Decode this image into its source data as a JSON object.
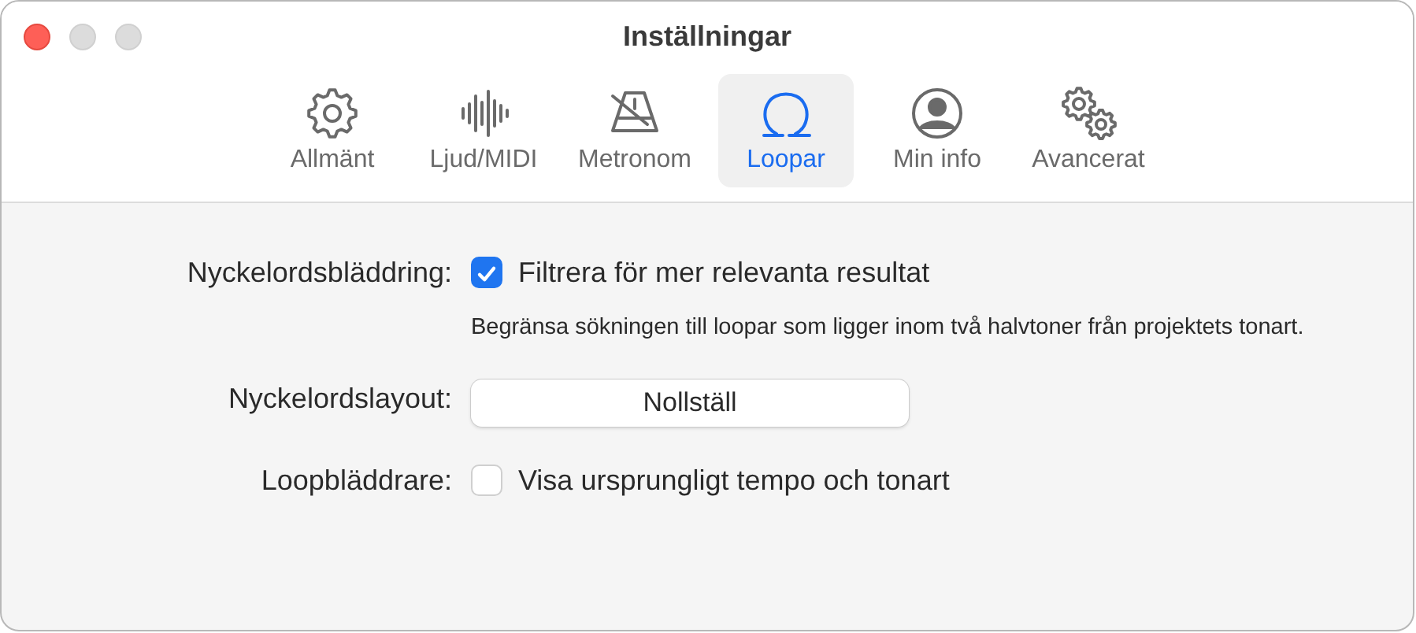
{
  "window": {
    "title": "Inställningar"
  },
  "tabs": [
    {
      "label": "Allmänt",
      "selected": false
    },
    {
      "label": "Ljud/MIDI",
      "selected": false
    },
    {
      "label": "Metronom",
      "selected": false
    },
    {
      "label": "Loopar",
      "selected": true
    },
    {
      "label": "Min info",
      "selected": false
    },
    {
      "label": "Avancerat",
      "selected": false
    }
  ],
  "rows": [
    {
      "kind": "checkbox",
      "label": "Nyckelordsbläddring:",
      "text": "Filtrera för mer relevanta resultat",
      "checked": true,
      "note": "Begränsa sökningen till loopar som ligger inom två halvtoner från projektets tonart."
    },
    {
      "kind": "button",
      "label": "Nyckelordslayout:",
      "text": "Nollställ"
    },
    {
      "kind": "checkbox",
      "label": "Loopbläddrare:",
      "text": "Visa ursprungligt tempo och tonart",
      "checked": false
    }
  ]
}
